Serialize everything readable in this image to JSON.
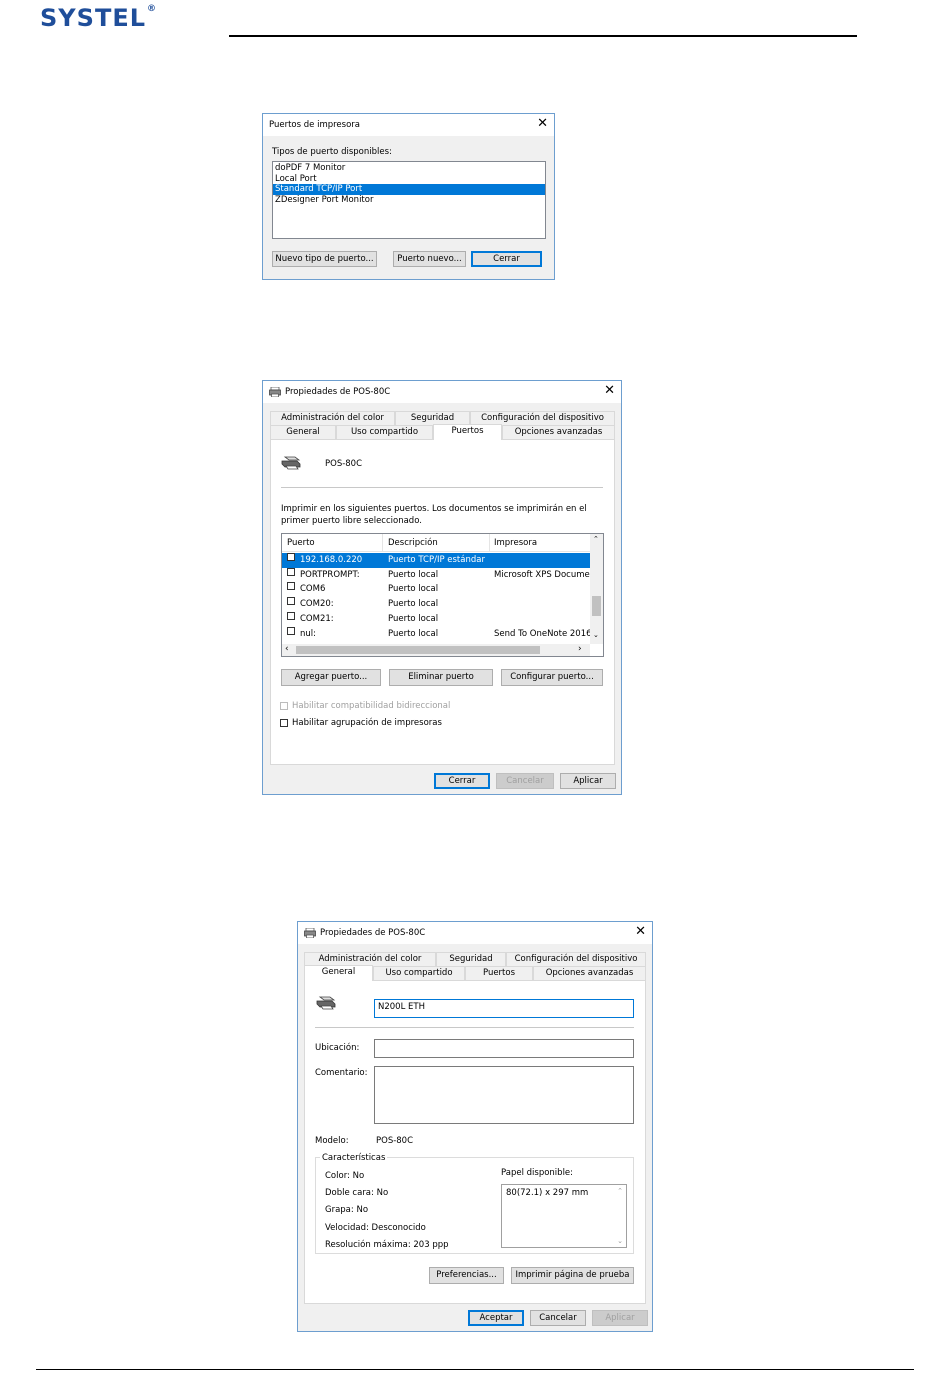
{
  "header": {
    "logo_text": "SYSTEL",
    "logo_mark": "®"
  },
  "dialog1": {
    "title": "Puertos de impresora",
    "list_label": "Tipos de puerto disponibles:",
    "port_types": [
      "doPDF 7 Monitor",
      "Local Port",
      "Standard TCP/IP Port",
      "ZDesigner Port Monitor"
    ],
    "selected_index": 2,
    "buttons": {
      "new_type": "Nuevo tipo de puerto...",
      "new_port": "Puerto nuevo...",
      "close": "Cerrar"
    }
  },
  "dialog2": {
    "title": "Propiedades de POS-80C",
    "tabs_row1": [
      "Administración del color",
      "Seguridad",
      "Configuración del dispositivo"
    ],
    "tabs_row2": [
      "General",
      "Uso compartido",
      "Puertos",
      "Opciones avanzadas"
    ],
    "active_tab": "Puertos",
    "printer_name": "POS-80C",
    "instructions": "Imprimir en los siguientes puertos. Los documentos se imprimirán en el primer puerto libre seleccionado.",
    "columns": [
      "Puerto",
      "Descripción",
      "Impresora"
    ],
    "rows": [
      {
        "port": "192.168.0.220",
        "desc": "Puerto TCP/IP estándar",
        "printer": "",
        "checked": true,
        "selected": true
      },
      {
        "port": "PORTPROMPT:",
        "desc": "Puerto local",
        "printer": "Microsoft XPS Docume",
        "checked": false,
        "selected": false
      },
      {
        "port": "COM6",
        "desc": "Puerto local",
        "printer": "",
        "checked": false,
        "selected": false
      },
      {
        "port": "COM20:",
        "desc": "Puerto local",
        "printer": "",
        "checked": false,
        "selected": false
      },
      {
        "port": "COM21:",
        "desc": "Puerto local",
        "printer": "",
        "checked": false,
        "selected": false
      },
      {
        "port": "nul:",
        "desc": "Puerto local",
        "printer": "Send To OneNote 2016",
        "checked": false,
        "selected": false
      }
    ],
    "buttons": {
      "add": "Agregar puerto...",
      "delete": "Eliminar puerto",
      "configure": "Configurar puerto..."
    },
    "bidirectional_label": "Habilitar compatibilidad bidireccional",
    "pooling_label": "Habilitar agrupación de impresoras",
    "footer": {
      "close": "Cerrar",
      "cancel": "Cancelar",
      "apply": "Aplicar"
    }
  },
  "dialog3": {
    "title": "Propiedades de POS-80C",
    "tabs_row1": [
      "Administración del color",
      "Seguridad",
      "Configuración del dispositivo"
    ],
    "tabs_row2": [
      "General",
      "Uso compartido",
      "Puertos",
      "Opciones avanzadas"
    ],
    "active_tab": "General",
    "printer_name_value": "N200L ETH",
    "location_label": "Ubicación:",
    "location_value": "",
    "comment_label": "Comentario:",
    "comment_value": "",
    "model_label": "Modelo:",
    "model_value": "POS-80C",
    "features_label": "Características",
    "features": [
      "Color: No",
      "Doble cara: No",
      "Grapa: No",
      "Velocidad: Desconocido",
      "Resolución máxima: 203 ppp"
    ],
    "paper_label": "Papel disponible:",
    "paper_items": [
      "80(72.1) x 297 mm"
    ],
    "buttons": {
      "preferences": "Preferencias...",
      "test_page": "Imprimir página de prueba"
    },
    "footer": {
      "ok": "Aceptar",
      "cancel": "Cancelar",
      "apply": "Aplicar"
    }
  }
}
